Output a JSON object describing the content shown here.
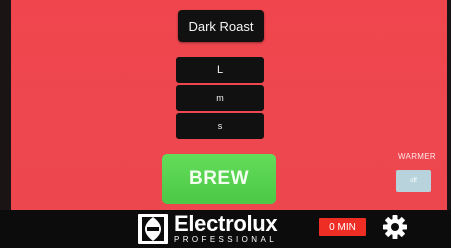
{
  "roast": {
    "label": "Dark Roast"
  },
  "sizes": [
    {
      "label": "L"
    },
    {
      "label": "m"
    },
    {
      "label": "s"
    }
  ],
  "brew": {
    "label": "BREW"
  },
  "warmer": {
    "label": "WARMER",
    "state": "off"
  },
  "footer": {
    "brand": "Electrolux",
    "brand_sub": "PROFESSIONAL",
    "timer": "0 MIN",
    "settings_icon": "gear-icon"
  },
  "colors": {
    "background": "#ee4750",
    "button_dark": "#111111",
    "brew_green": "#55d04e",
    "timer_red": "#ee2d25",
    "warmer_off": "#b9d3dd",
    "footer_bg": "#0c0c0c"
  }
}
